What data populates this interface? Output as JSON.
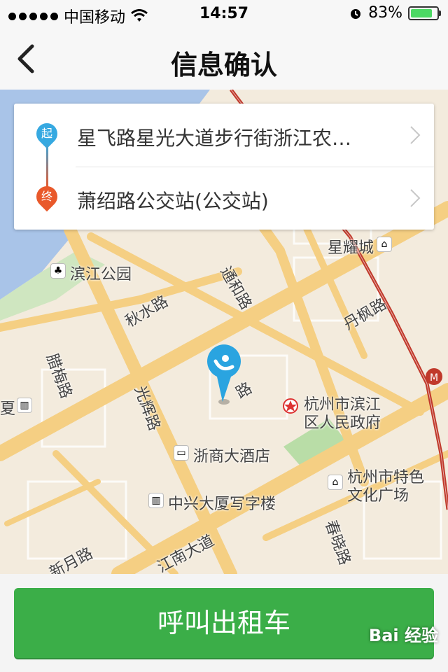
{
  "status_bar": {
    "carrier": "中国移动",
    "time": "14:57",
    "battery": "83%",
    "battery_level": 0.83,
    "battery_color": "#4cd964"
  },
  "nav": {
    "title": "信息确认",
    "back_icon": "chevron-left-icon"
  },
  "route": {
    "start_badge": "起",
    "start_text": "星飞路星光大道步行街浙江农…",
    "end_badge": "终",
    "end_text": "萧绍路公交站(公交站)",
    "start_color": "#36a9e1",
    "end_color": "#e9592b"
  },
  "map": {
    "labels": {
      "xingyaocheng": "星耀城",
      "binjiang_park": "滨江公园",
      "tonghe_road": "通和路",
      "qiushui_road": "秋水路",
      "danfeng_road": "丹枫路",
      "layuan_road": "腊梅路",
      "guanghui_road": "光辉路",
      "xia": "夏",
      "gov_line1": "杭州市滨江",
      "gov_line2": "区人民政府",
      "zheshang_hotel": "浙商大酒店",
      "culture_line1": "杭州市特色",
      "culture_line2": "文化广场",
      "zhongxing_tower": "中兴大厦写字楼",
      "jiangnan_road": "江南大道",
      "chunxiao_road": "春晓路",
      "xinyue_road": "新月路",
      "lu": "路"
    },
    "road_color": "#f5cf83",
    "water_color": "#a9c4e8",
    "metro_color": "#c0392b"
  },
  "action": {
    "call_label": "呼叫出租车",
    "color": "#3bae48"
  },
  "watermark": "Bai 经验"
}
